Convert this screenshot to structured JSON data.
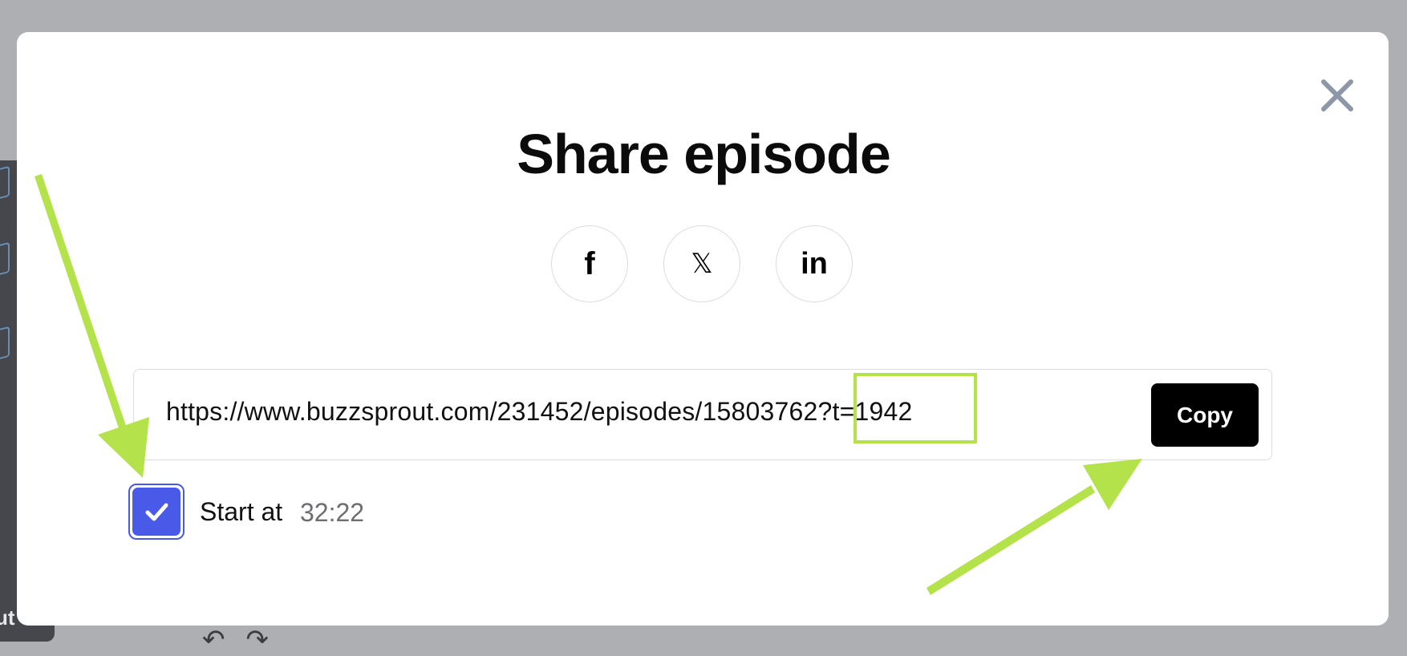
{
  "modal": {
    "title": "Share episode",
    "close_icon": "close-icon"
  },
  "social": {
    "facebook": {
      "icon": "facebook-icon",
      "glyph": "f"
    },
    "x": {
      "icon": "x-icon",
      "glyph": "𝕏"
    },
    "linkedin": {
      "icon": "linkedin-icon",
      "glyph": "in"
    }
  },
  "share": {
    "url": "https://www.buzzsprout.com/231452/episodes/15803762?t=1942",
    "copy_label": "Copy"
  },
  "start_at": {
    "checked": true,
    "label": "Start at",
    "time": "32:22"
  },
  "background": {
    "partial_text": "ut"
  },
  "colors": {
    "accent": "#4a5ae8",
    "annotation": "#b4e24a",
    "copy_button": "#000000"
  }
}
